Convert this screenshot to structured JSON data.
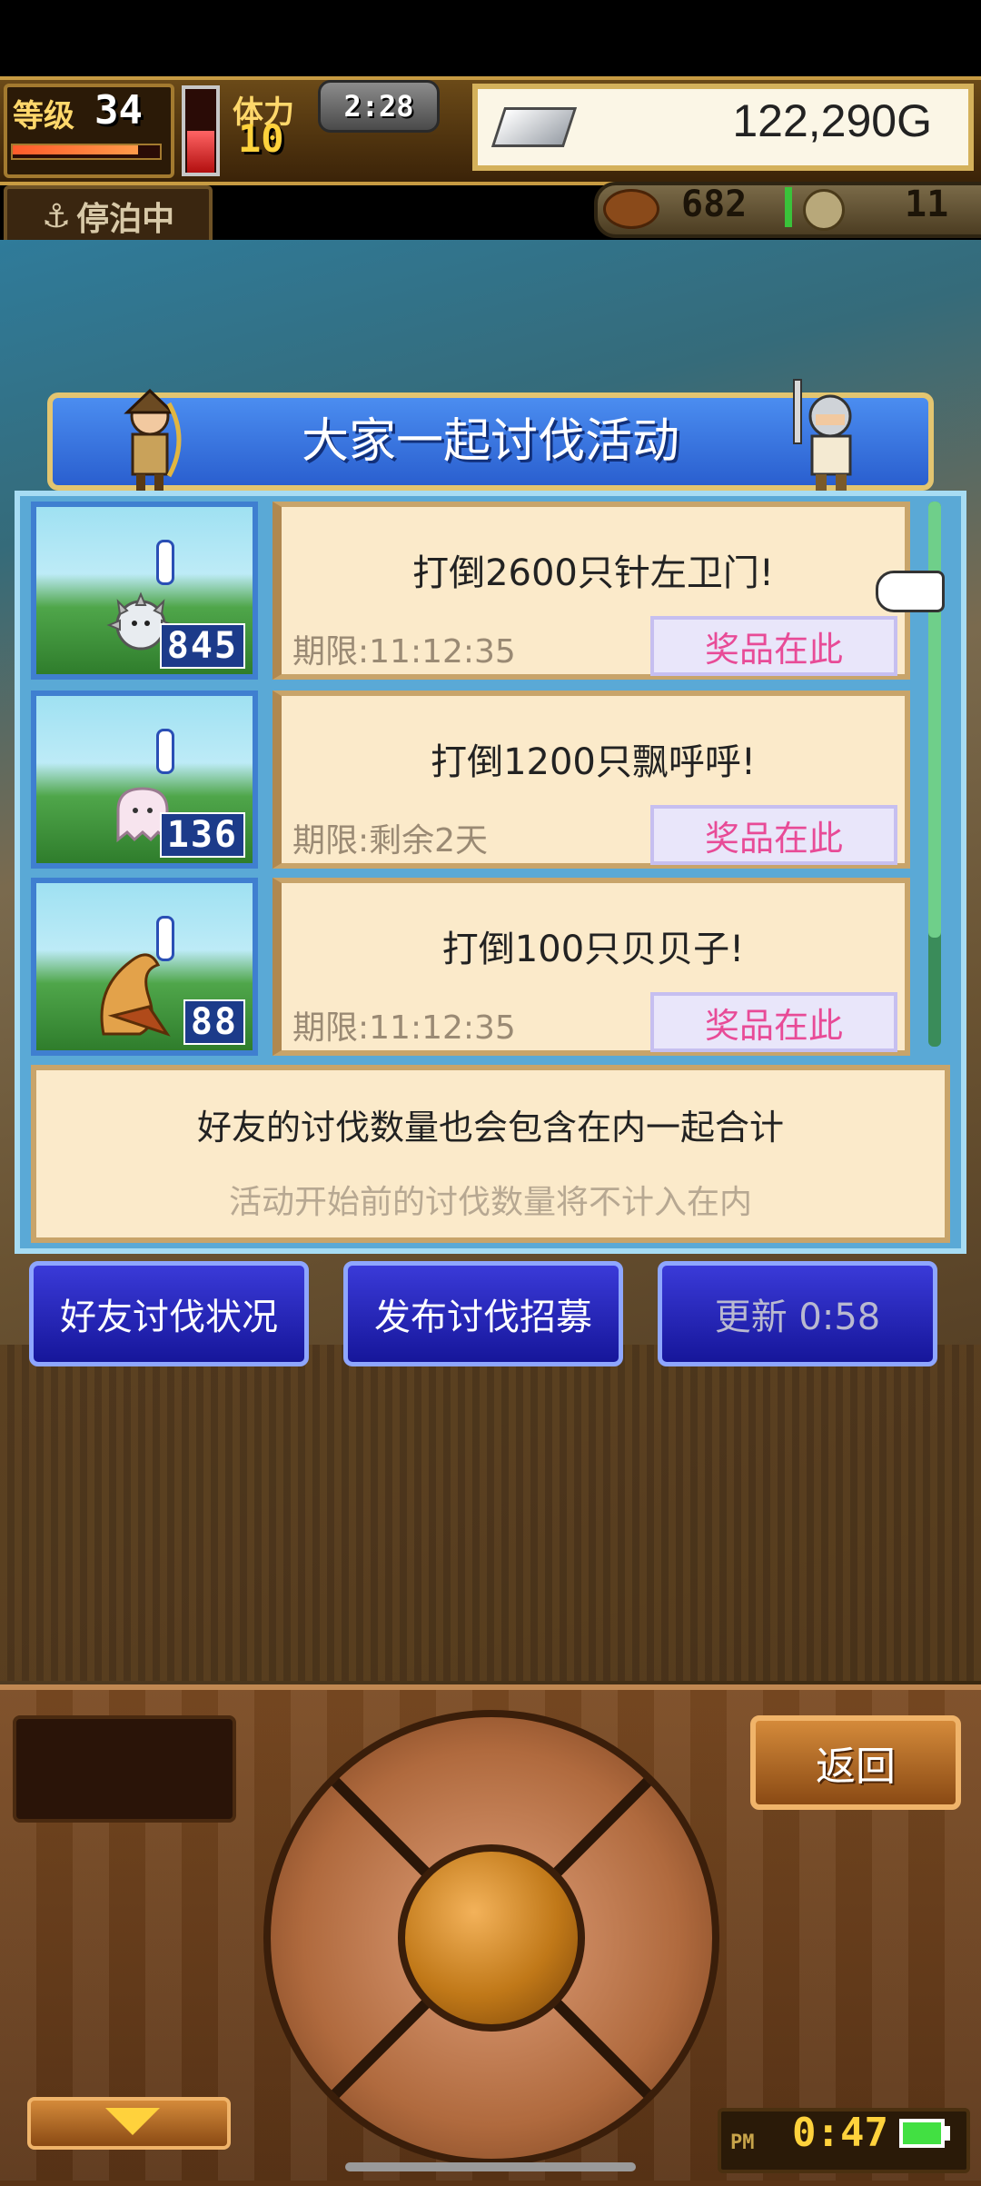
{
  "hud": {
    "level_label": "等级",
    "level": "34",
    "level_progress": 0.85,
    "stamina_label": "体力",
    "stamina": "10",
    "stamina_gauge_fill": 0.5,
    "timer": "2:28",
    "gold": "122,290G",
    "status": "停泊中",
    "food": "682",
    "coins": "11"
  },
  "dialog": {
    "title": "大家一起讨伐活动",
    "quests": [
      {
        "name": "打倒2600只针左卫门!",
        "deadline": "期限:11:12:35",
        "prize_label": "奖品在此",
        "count": "845"
      },
      {
        "name": "打倒1200只飘呼呼!",
        "deadline": "期限:剩余2天",
        "prize_label": "奖品在此",
        "count": "136"
      },
      {
        "name": "打倒100只贝贝子!",
        "deadline": "期限:11:12:35",
        "prize_label": "奖品在此",
        "count": "88"
      }
    ],
    "info_line1": "好友的讨伐数量也会包含在内一起合计",
    "info_line2": "活动开始前的讨伐数量将不计入在内"
  },
  "buttons": {
    "friend_status": "好友讨伐状况",
    "publish_recruit": "发布讨伐招募",
    "refresh": "更新 0:58",
    "back": "返回"
  },
  "clock": {
    "ampm": "PM",
    "time": "0:47"
  },
  "colors": {
    "title_blue": "#2a5fcf",
    "prize_pink": "#e84b97",
    "card_cream": "#fbeaca",
    "button_blue": "#16169a"
  }
}
